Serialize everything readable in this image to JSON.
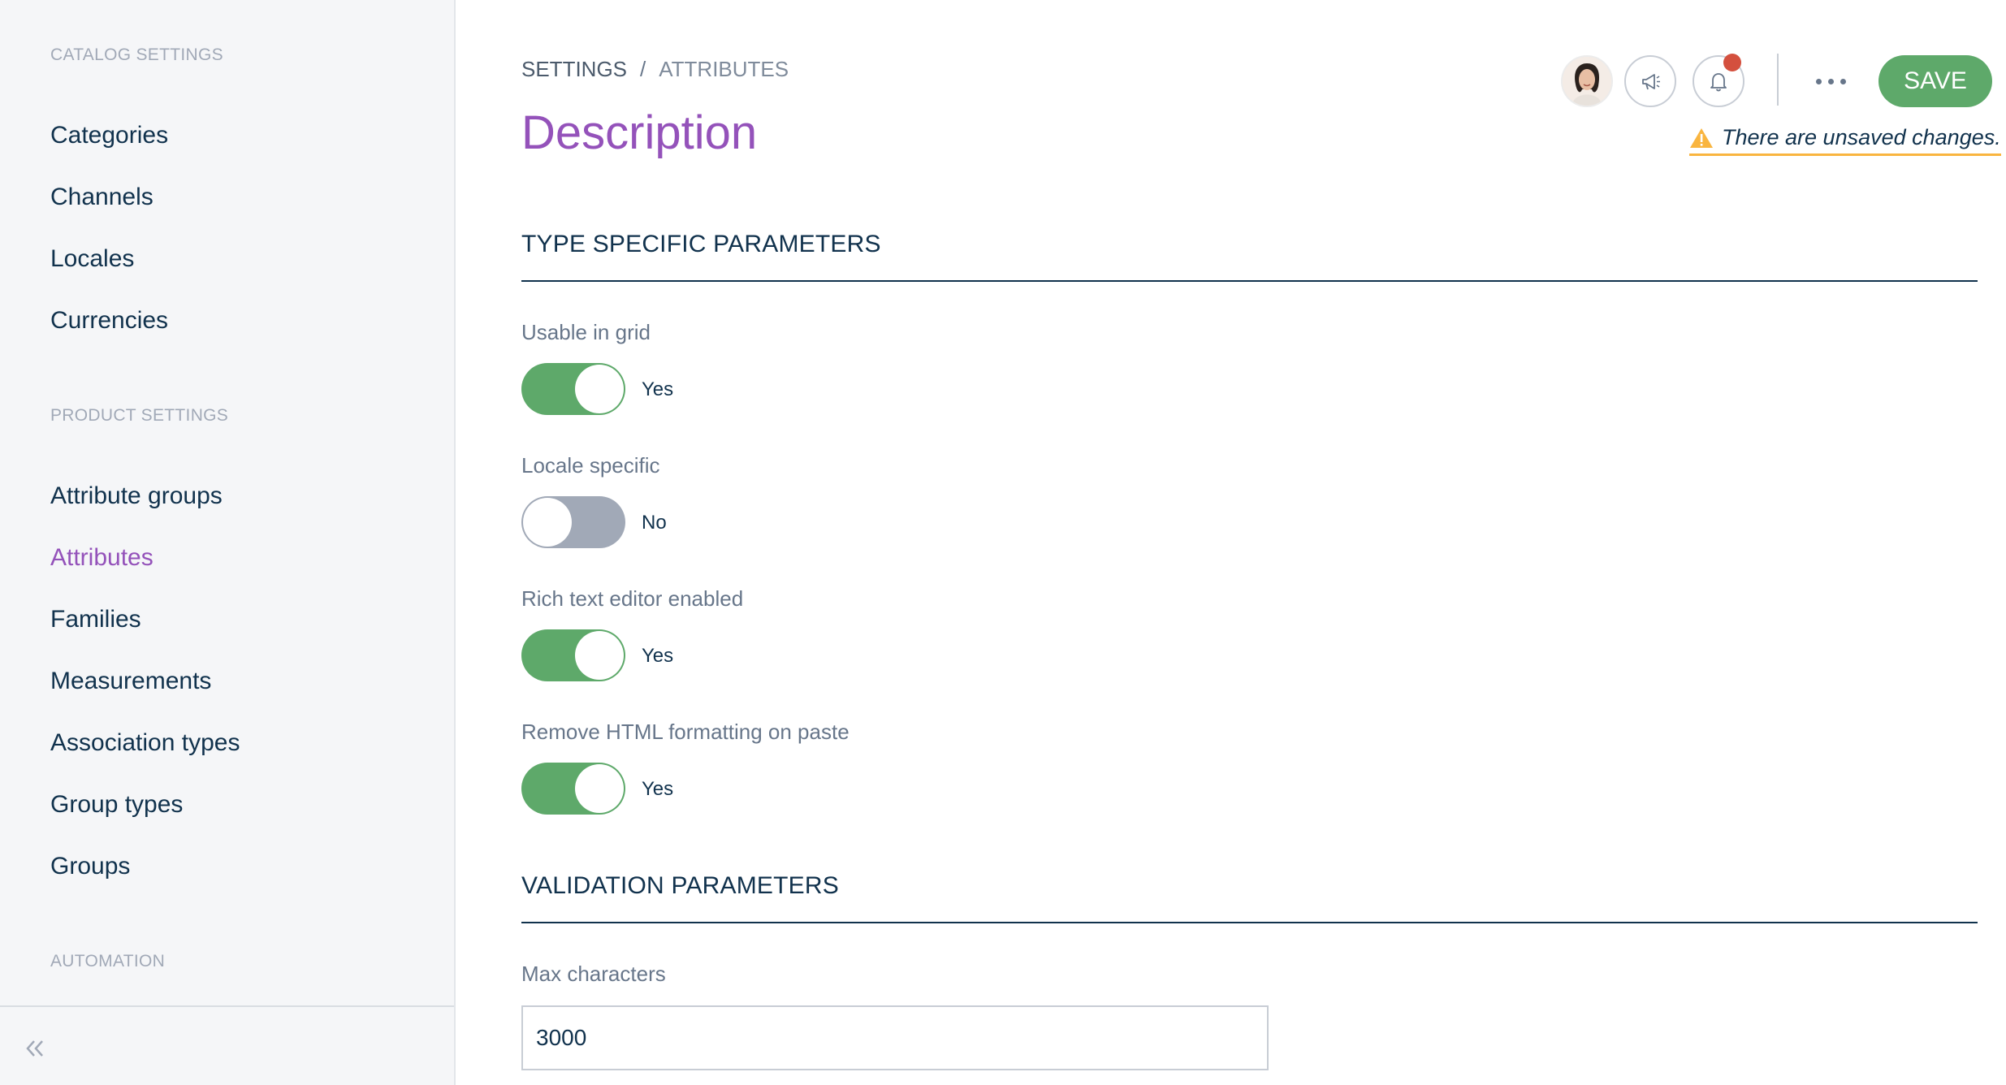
{
  "sidebar": {
    "catalog_section": "CATALOG SETTINGS",
    "catalog_items": [
      "Categories",
      "Channels",
      "Locales",
      "Currencies"
    ],
    "product_section": "PRODUCT SETTINGS",
    "product_items": [
      "Attribute groups",
      "Attributes",
      "Families",
      "Measurements",
      "Association types",
      "Group types",
      "Groups"
    ],
    "active_item": "Attributes",
    "automation_section": "AUTOMATION"
  },
  "breadcrumb": {
    "root": "SETTINGS",
    "separator": "/",
    "current": "ATTRIBUTES"
  },
  "page_title": "Description",
  "header": {
    "save_label": "SAVE",
    "unsaved_text": "There are unsaved changes."
  },
  "sections": {
    "type_specific": "TYPE SPECIFIC PARAMETERS",
    "validation": "VALIDATION PARAMETERS"
  },
  "fields": [
    {
      "label": "Usable in grid",
      "enabled": true,
      "state_text": "Yes"
    },
    {
      "label": "Locale specific",
      "enabled": false,
      "state_text": "No"
    },
    {
      "label": "Rich text editor enabled",
      "enabled": true,
      "state_text": "Yes"
    },
    {
      "label": "Remove HTML formatting on paste",
      "enabled": true,
      "state_text": "Yes"
    }
  ],
  "max_characters": {
    "label": "Max characters",
    "value": "3000"
  },
  "colors": {
    "accent": "#9452ba",
    "success": "#5ea96a",
    "warning": "#f9b53f",
    "text": "#11324d"
  }
}
